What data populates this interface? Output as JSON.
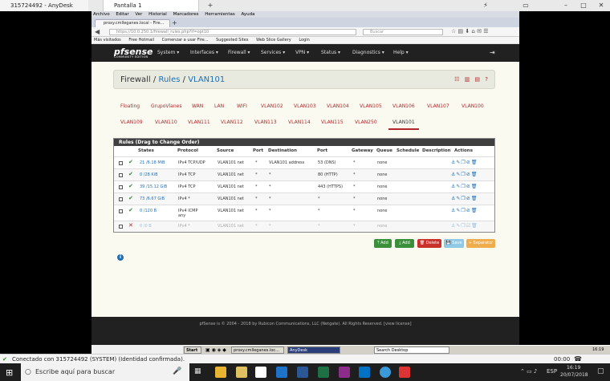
{
  "anydesk": {
    "tab1": "315724492 - AnyDesk",
    "tab2": "Pantalla 1",
    "status": "Conectado con 315724492 (SYSTEM) (Identidad confirmada).",
    "timer": "00:00"
  },
  "firefox": {
    "menu": [
      "Archivo",
      "Editar",
      "Ver",
      "Historial",
      "Marcadores",
      "Herramientas",
      "Ayuda"
    ],
    "tab_title": "proxy.cmlleganes.local - Fire...",
    "url": "https://10.0.250.1/firewall_rules.php?if=opt10",
    "search_placeholder": "Buscar",
    "bookmarks": [
      "Más visitados",
      "Free Hotmail",
      "Comenzar a usar Fire...",
      "Suggested Sites",
      "Web Slice Gallery",
      "Login"
    ]
  },
  "pfsense": {
    "logo": "pfsense",
    "logo_sub": "COMMUNITY EDITION",
    "nav": [
      "System ▾",
      "Interfaces ▾",
      "Firewall ▾",
      "Services ▾",
      "VPN ▾",
      "Status ▾",
      "Diagnostics ▾",
      "Help ▾"
    ],
    "crumb": {
      "a": "Firewall",
      "b": "Rules",
      "c": "VLAN101",
      "sep": "/"
    },
    "tabs_row1": [
      "Floating",
      "GrupoVlanes",
      "WAN",
      "LAN",
      "WIFI",
      "VLAN102",
      "VLAN103",
      "VLAN104",
      "VLAN105",
      "VLAN106",
      "VLAN107",
      "VLAN100"
    ],
    "tabs_row2": [
      "VLAN109",
      "VLAN110",
      "VLAN111",
      "VLAN112",
      "VLAN113",
      "VLAN114",
      "VLAN115",
      "VLAN250",
      "VLAN101"
    ],
    "rules_title": "Rules (Drag to Change Order)",
    "headers": [
      "States",
      "Protocol",
      "Source",
      "Port",
      "Destination",
      "Port",
      "Gateway",
      "Queue",
      "Schedule",
      "Description",
      "Actions"
    ],
    "rows": [
      {
        "states": "21 /6.18 MiB",
        "protocol": "IPv4 TCP/UDP",
        "source": "VLAN101 net",
        "sport": "*",
        "dest": "VLAN101 address",
        "dport": "53 (DNS)",
        "gw": "*",
        "queue": "none",
        "enabled": true
      },
      {
        "states": "0 /28 KiB",
        "protocol": "IPv4 TCP",
        "source": "VLAN101 net",
        "sport": "*",
        "dest": "*",
        "dport": "80 (HTTP)",
        "gw": "*",
        "queue": "none",
        "enabled": true
      },
      {
        "states": "39 /15.12 GiB",
        "protocol": "IPv4 TCP",
        "source": "VLAN101 net",
        "sport": "*",
        "dest": "*",
        "dport": "443 (HTTPS)",
        "gw": "*",
        "queue": "none",
        "enabled": true
      },
      {
        "states": "73 /6.67 GiB",
        "protocol": "IPv4 *",
        "source": "VLAN101 net",
        "sport": "*",
        "dest": "*",
        "dport": "*",
        "gw": "*",
        "queue": "none",
        "enabled": true
      },
      {
        "states": "0 /120 B",
        "protocol": "IPv4 ICMP any",
        "source": "VLAN101 net",
        "sport": "*",
        "dest": "*",
        "dport": "*",
        "gw": "*",
        "queue": "none",
        "enabled": true
      },
      {
        "states": "0 /0 B",
        "protocol": "IPv4 *",
        "source": "VLAN101 net",
        "sport": "*",
        "dest": "*",
        "dport": "*",
        "gw": "*",
        "queue": "none",
        "enabled": false
      }
    ],
    "buttons": {
      "add_top": "Add",
      "add_bottom": "Add",
      "delete": "Delete",
      "save": "Save",
      "separator": "Separator"
    },
    "footer": "pfSense is © 2004 - 2018 by Rubicon Communications, LLC (Netgate). All Rights Reserved. [view license]"
  },
  "remote_taskbar": {
    "start": "Start",
    "task1": "proxy.cmlleganes.loc...",
    "task2": "AnyDesk",
    "search": "Search Desktop",
    "clock": "16:19"
  },
  "windows": {
    "search": "Escribe aquí para buscar",
    "lang": "ESP",
    "time": "16:19",
    "date": "20/07/2018"
  },
  "colors": {
    "pf_nav": "#212121",
    "tab_red": "#b0282c",
    "link_blue": "#1e6fb5",
    "btn_green": "#3a8f3a",
    "btn_red": "#c9302c",
    "btn_blue": "#5bc0de",
    "btn_orange": "#f0ad4e"
  }
}
